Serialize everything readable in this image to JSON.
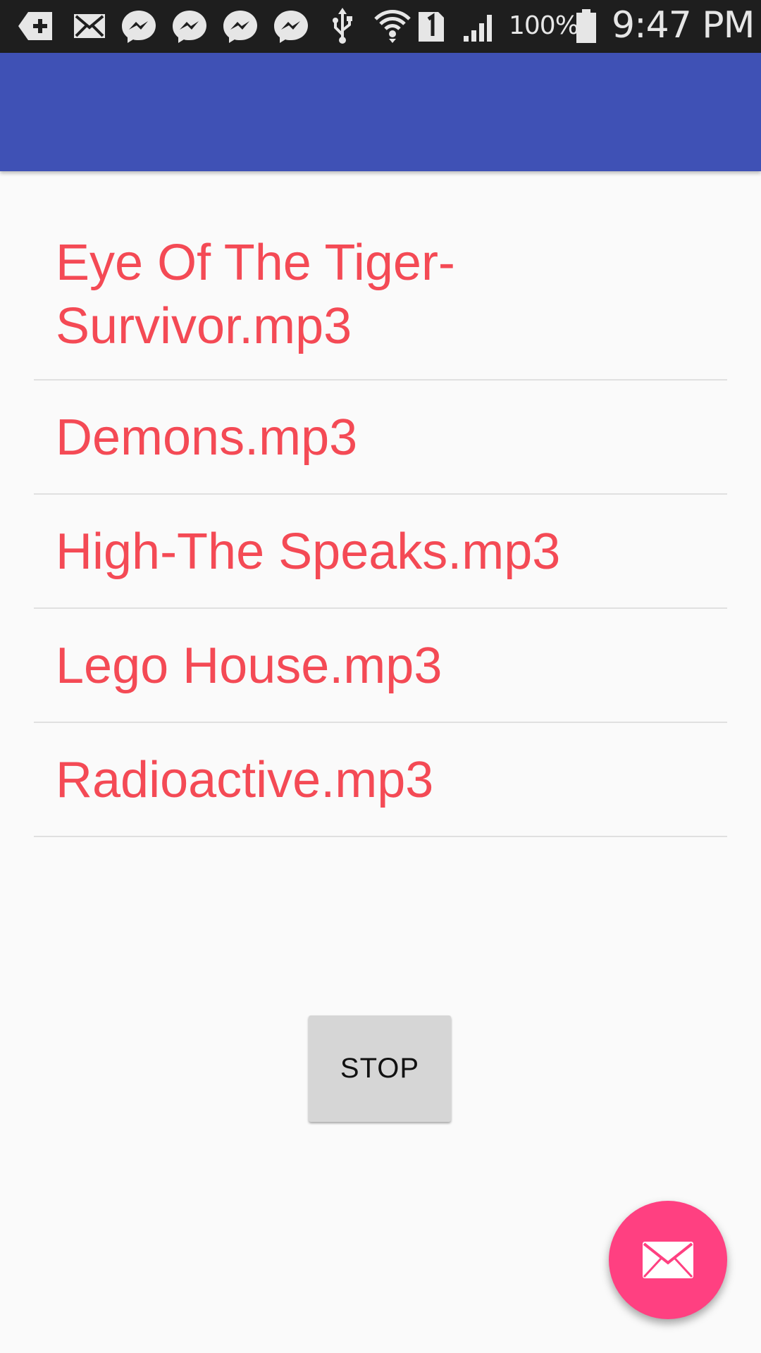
{
  "status_bar": {
    "icons": [
      "add-box-icon",
      "mail-icon",
      "messenger-icon",
      "messenger-icon",
      "messenger-icon",
      "messenger-icon",
      "usb-icon",
      "wifi-icon",
      "sim-1-icon",
      "signal-icon",
      "battery-icon"
    ],
    "battery_percent": "100%",
    "time": "9:47 PM"
  },
  "app_bar": {
    "title": ""
  },
  "songs": [
    {
      "label": "Eye Of The Tiger-Survivor.mp3"
    },
    {
      "label": "Demons.mp3"
    },
    {
      "label": "High-The Speaks.mp3"
    },
    {
      "label": "Lego House.mp3"
    },
    {
      "label": "Radioactive.mp3"
    }
  ],
  "controls": {
    "stop_label": "STOP"
  },
  "fab": {
    "icon": "mail-icon"
  },
  "colors": {
    "status_bar": "#1e1e1e",
    "app_bar": "#3f51b5",
    "song_text": "#f44a55",
    "fab": "#ff4081",
    "background": "#fafafa"
  }
}
